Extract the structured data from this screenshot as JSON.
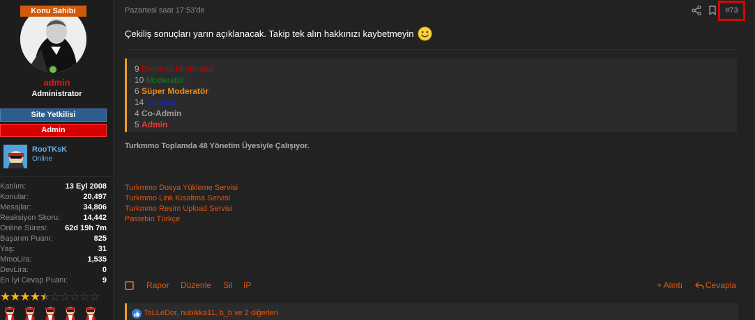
{
  "user": {
    "badge": "Konu Sahibi",
    "name": "admin",
    "title": "Administrator",
    "banners": [
      "Site Yetkilisi",
      "Admin"
    ],
    "group_name": "RooTKsK",
    "group_status": "Online",
    "stats": [
      {
        "label": "Katılım:",
        "value": "13 Eyl 2008"
      },
      {
        "label": "Konular:",
        "value": "20,497"
      },
      {
        "label": "Mesajlar:",
        "value": "34,806"
      },
      {
        "label": "Reaksiyon Skoru:",
        "value": "14,442"
      },
      {
        "label": "Online Süresi:",
        "value": "62d 19h 7m"
      },
      {
        "label": "Başarım Puanı:",
        "value": "825"
      },
      {
        "label": "Yaş:",
        "value": "31"
      },
      {
        "label": "MmoLira:",
        "value": "1,535"
      },
      {
        "label": "DevLira:",
        "value": "0"
      },
      {
        "label": "En İyi Cevap Puanı:",
        "value": "9"
      }
    ],
    "rating_stars_filled": 4.5,
    "rating_stars_total": 10,
    "award_count": 5
  },
  "post": {
    "timestamp": "Pazartesi saat 17:53'de",
    "number": "#73",
    "text": "Çekiliş sonuçları yarın açıklanacak. Takip tek alın hakkınızı kaybetmeyin",
    "staff_list": [
      {
        "count": "9",
        "role": "Deneme Moderatör"
      },
      {
        "count": "10",
        "role": "Moderatör"
      },
      {
        "count": "6",
        "role": "Süper Moderatör"
      },
      {
        "count": "14",
        "role": "Yönetici"
      },
      {
        "count": "4",
        "role": "Co-Admin"
      },
      {
        "count": "5",
        "role": "Admin"
      }
    ],
    "summary": "Turkmmo Toplamda 48 Yönetim Üyesiyle Çalışıyor.",
    "signature_links": [
      "Turkmmo Dosya Yükleme Servisi",
      "Turkmmo Link Kısaltma Servisi",
      "Turkmmo Resim Upload Servisi",
      "Pastebin Türkçe"
    ],
    "actions": {
      "report": "Rapor",
      "edit": "Düzenle",
      "delete": "Sil",
      "ip": "IP",
      "quote": "+ Alıntı",
      "reply": "Cevapla"
    },
    "reactions": "ToLLeDor, nubikka11, b_b ve 2 diğerleri"
  },
  "colors": {
    "accent": "#e2550c",
    "highlight_box": "#e00000",
    "quote_border": "#f09d1b"
  }
}
